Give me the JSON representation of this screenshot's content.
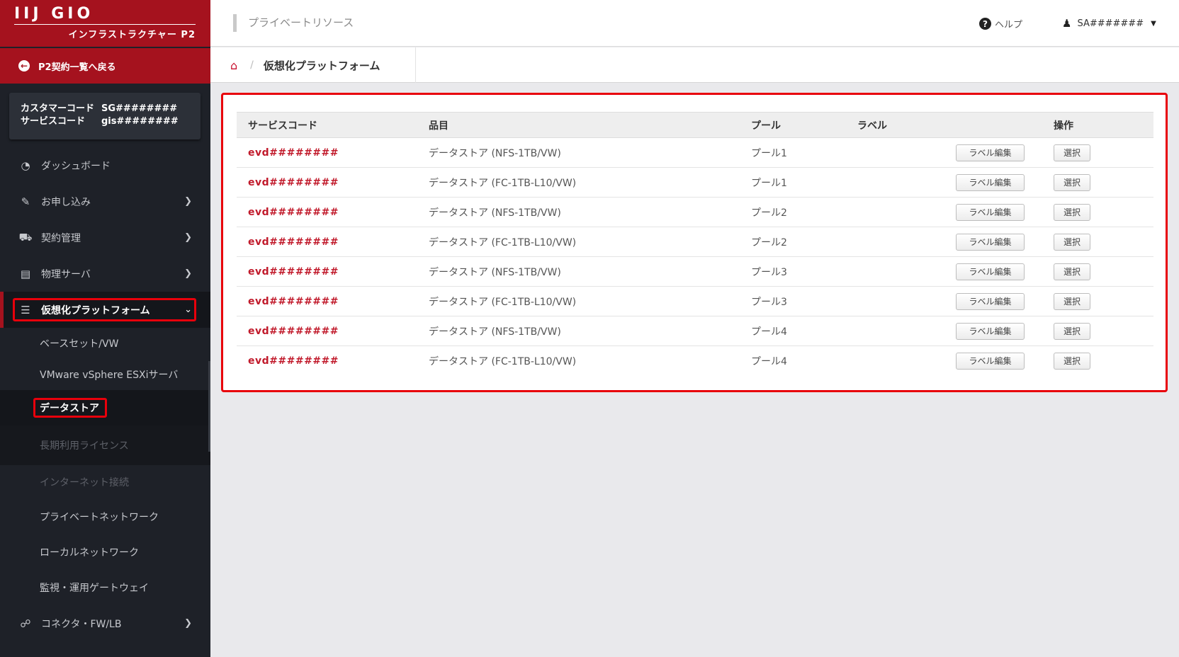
{
  "brand": {
    "logo": "IIJ GIO",
    "subtitle": "インフラストラクチャー P2"
  },
  "sidebar": {
    "back_label": "P2契約一覧へ戻る",
    "customer_code_label": "カスタマーコード",
    "customer_code_value": "SG########",
    "service_code_label": "サービスコード",
    "service_code_value": "gis########",
    "items": [
      {
        "label": "ダッシュボード",
        "icon": "dashboard-icon"
      },
      {
        "label": "お申し込み",
        "icon": "edit-icon"
      },
      {
        "label": "契約管理",
        "icon": "truck-icon"
      },
      {
        "label": "物理サーバ",
        "icon": "server-icon"
      },
      {
        "label": "仮想化プラットフォーム",
        "icon": "list-icon"
      }
    ],
    "sub_items": [
      {
        "label": "ベースセット/VW"
      },
      {
        "label": "VMware vSphere ESXiサーバ"
      },
      {
        "label": "データストア"
      },
      {
        "label": "長期利用ライセンス"
      }
    ],
    "more_items": [
      {
        "label": "インターネット接続"
      },
      {
        "label": "プライベートネットワーク"
      },
      {
        "label": "ローカルネットワーク"
      },
      {
        "label": "監視・運用ゲートウェイ"
      }
    ],
    "connector_label": "コネクタ・FW/LB"
  },
  "header": {
    "page_title": "プライベートリソース",
    "help_label": "ヘルプ",
    "user_label": "SA#######"
  },
  "breadcrumb": {
    "current": "仮想化プラットフォーム"
  },
  "table": {
    "columns": [
      "サービスコード",
      "品目",
      "プール",
      "ラベル",
      "操作"
    ],
    "edit_label": "ラベル編集",
    "select_label": "選択",
    "rows": [
      {
        "code": "evd########",
        "item": "データストア (NFS-1TB/VW)",
        "pool": "プール1",
        "label": ""
      },
      {
        "code": "evd########",
        "item": "データストア (FC-1TB-L10/VW)",
        "pool": "プール1",
        "label": ""
      },
      {
        "code": "evd########",
        "item": "データストア (NFS-1TB/VW)",
        "pool": "プール2",
        "label": ""
      },
      {
        "code": "evd########",
        "item": "データストア (FC-1TB-L10/VW)",
        "pool": "プール2",
        "label": ""
      },
      {
        "code": "evd########",
        "item": "データストア (NFS-1TB/VW)",
        "pool": "プール3",
        "label": ""
      },
      {
        "code": "evd########",
        "item": "データストア (FC-1TB-L10/VW)",
        "pool": "プール3",
        "label": ""
      },
      {
        "code": "evd########",
        "item": "データストア (NFS-1TB/VW)",
        "pool": "プール4",
        "label": ""
      },
      {
        "code": "evd########",
        "item": "データストア (FC-1TB-L10/VW)",
        "pool": "プール4",
        "label": ""
      }
    ]
  },
  "colors": {
    "brand_red": "#a5121e",
    "highlight_red": "#e8000b",
    "code_red": "#c11a2b",
    "sidebar_bg": "#1e2128"
  }
}
